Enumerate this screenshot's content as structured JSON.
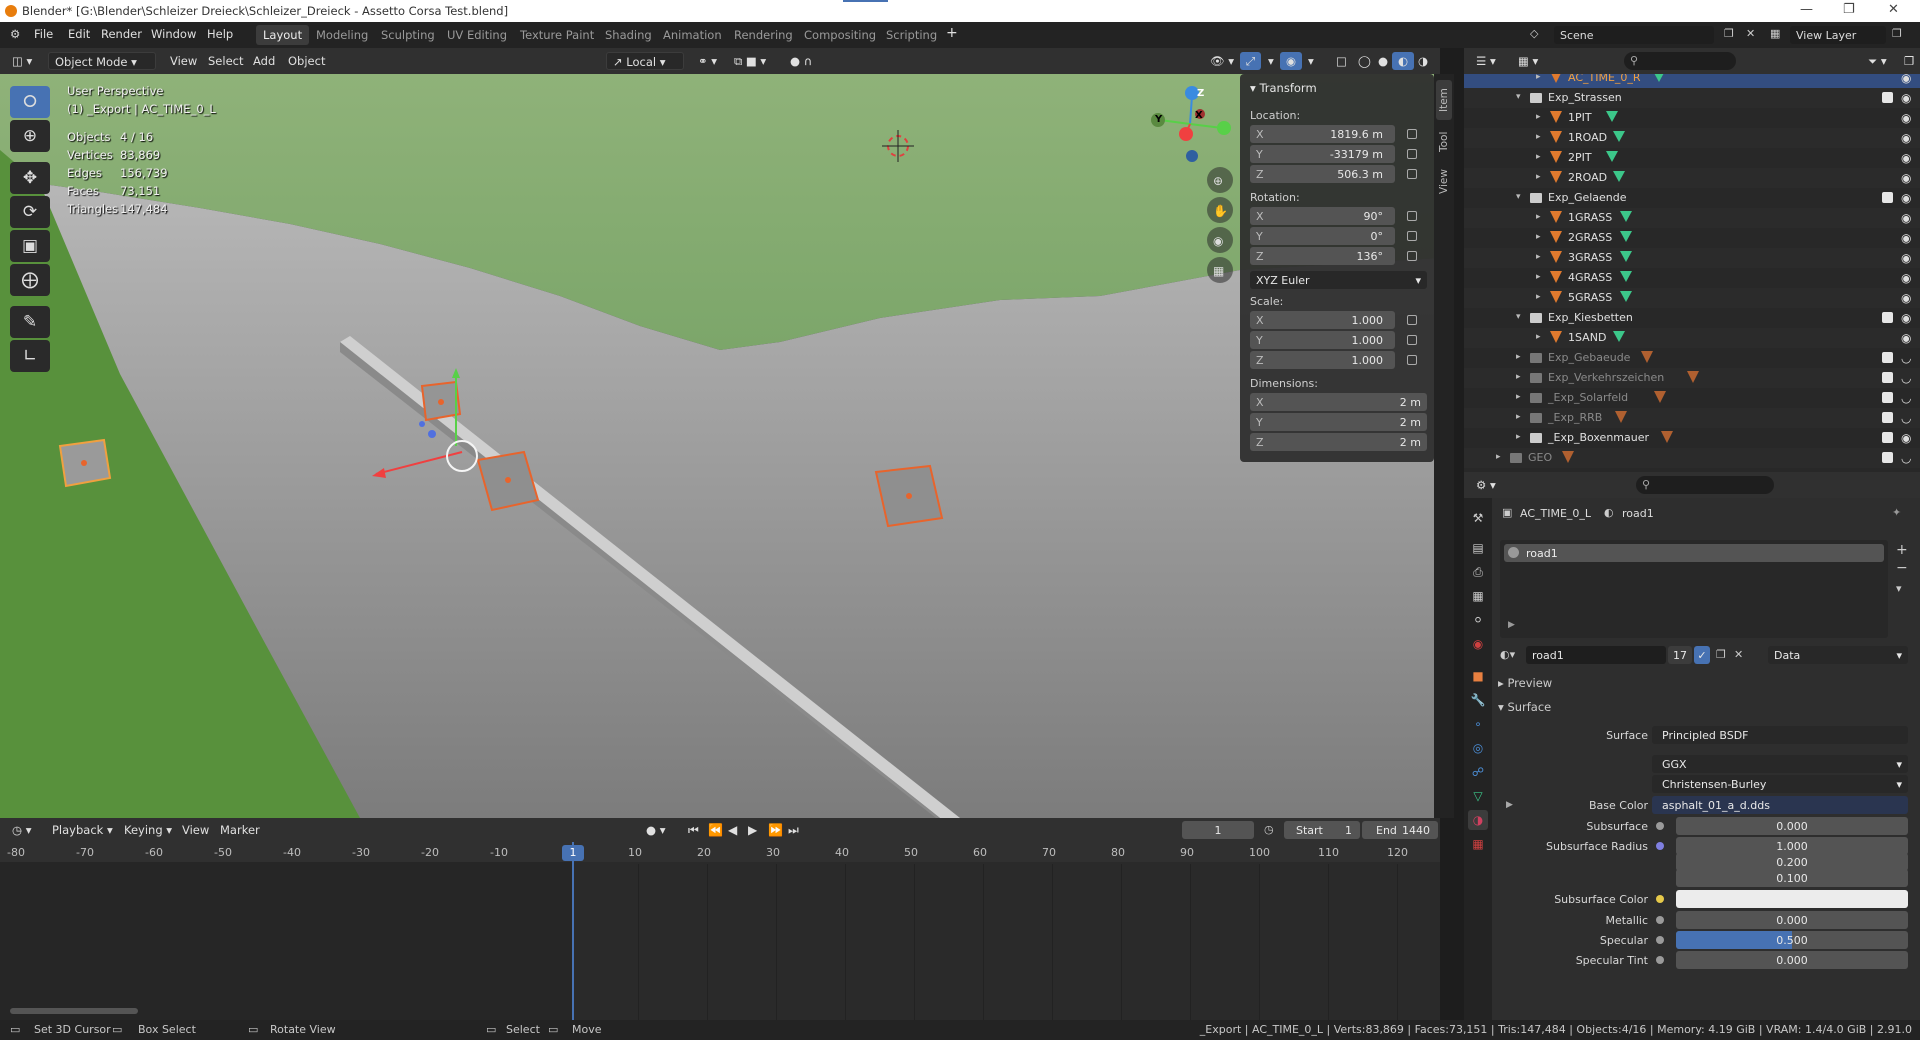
{
  "window": {
    "title": "Blender* [G:\\Blender\\Schleizer Dreieck\\Schleizer_Dreieck - Assetto Corsa Test.blend]"
  },
  "menu": {
    "items": [
      "File",
      "Edit",
      "Render",
      "Window",
      "Help"
    ]
  },
  "workspaces": [
    "Layout",
    "Modeling",
    "Sculpting",
    "UV Editing",
    "Texture Paint",
    "Shading",
    "Animation",
    "Rendering",
    "Compositing",
    "Scripting"
  ],
  "workspace_active": "Layout",
  "scene": {
    "name": "Scene",
    "view_layer": "View Layer"
  },
  "viewport_header": {
    "mode": "Object Mode",
    "view": "View",
    "select": "Select",
    "add": "Add",
    "object": "Object",
    "orientation": "Local"
  },
  "viewport": {
    "perspective": "User Perspective",
    "context": "(1) _Export | AC_TIME_0_L",
    "stats": [
      {
        "label": "Objects",
        "value": "4 / 16"
      },
      {
        "label": "Vertices",
        "value": "83,869"
      },
      {
        "label": "Edges",
        "value": "156,739"
      },
      {
        "label": "Faces",
        "value": "73,151"
      },
      {
        "label": "Triangles",
        "value": "147,484"
      }
    ],
    "gizmo_axes": {
      "x": "X",
      "y": "Y",
      "z": "Z"
    }
  },
  "npanel": {
    "title": "Transform",
    "tabs": [
      "Item",
      "Tool",
      "View"
    ],
    "location_label": "Location:",
    "location": [
      {
        "axis": "X",
        "value": "1819.6 m"
      },
      {
        "axis": "Y",
        "value": "-33179 m"
      },
      {
        "axis": "Z",
        "value": "506.3 m"
      }
    ],
    "rotation_label": "Rotation:",
    "rotation": [
      {
        "axis": "X",
        "value": "90°"
      },
      {
        "axis": "Y",
        "value": "0°"
      },
      {
        "axis": "Z",
        "value": "136°"
      }
    ],
    "rotation_mode": "XYZ Euler",
    "scale_label": "Scale:",
    "scale": [
      {
        "axis": "X",
        "value": "1.000"
      },
      {
        "axis": "Y",
        "value": "1.000"
      },
      {
        "axis": "Z",
        "value": "1.000"
      }
    ],
    "dimensions_label": "Dimensions:",
    "dimensions": [
      {
        "axis": "X",
        "value": "2 m"
      },
      {
        "axis": "Y",
        "value": "2 m"
      },
      {
        "axis": "Z",
        "value": "2 m"
      }
    ]
  },
  "outliner": {
    "rows": [
      {
        "label": "AC_TIME_0_R",
        "kind": "mesh",
        "indent": 3,
        "selected": true,
        "dim": false,
        "orange": true,
        "checkbox": false
      },
      {
        "label": "Exp_Strassen",
        "kind": "collection",
        "indent": 2,
        "selected": false,
        "dim": false,
        "orange": false,
        "checkbox": true
      },
      {
        "label": "1PIT",
        "kind": "mesh",
        "indent": 3,
        "selected": false,
        "dim": false,
        "orange": false,
        "checkbox": false
      },
      {
        "label": "1ROAD",
        "kind": "mesh",
        "indent": 3,
        "selected": false,
        "dim": false,
        "orange": false,
        "checkbox": false
      },
      {
        "label": "2PIT",
        "kind": "mesh",
        "indent": 3,
        "selected": false,
        "dim": false,
        "orange": false,
        "checkbox": false
      },
      {
        "label": "2ROAD",
        "kind": "mesh",
        "indent": 3,
        "selected": false,
        "dim": false,
        "orange": false,
        "checkbox": false
      },
      {
        "label": "Exp_Gelaende",
        "kind": "collection",
        "indent": 2,
        "selected": false,
        "dim": false,
        "orange": false,
        "checkbox": true
      },
      {
        "label": "1GRASS",
        "kind": "mesh",
        "indent": 3,
        "selected": false,
        "dim": false,
        "orange": false,
        "checkbox": false
      },
      {
        "label": "2GRASS",
        "kind": "mesh",
        "indent": 3,
        "selected": false,
        "dim": false,
        "orange": false,
        "checkbox": false
      },
      {
        "label": "3GRASS",
        "kind": "mesh",
        "indent": 3,
        "selected": false,
        "dim": false,
        "orange": false,
        "checkbox": false
      },
      {
        "label": "4GRASS",
        "kind": "mesh",
        "indent": 3,
        "selected": false,
        "dim": false,
        "orange": false,
        "checkbox": false
      },
      {
        "label": "5GRASS",
        "kind": "mesh",
        "indent": 3,
        "selected": false,
        "dim": false,
        "orange": false,
        "checkbox": false
      },
      {
        "label": "Exp_Kiesbetten",
        "kind": "collection",
        "indent": 2,
        "selected": false,
        "dim": false,
        "orange": false,
        "checkbox": true
      },
      {
        "label": "1SAND",
        "kind": "mesh",
        "indent": 3,
        "selected": false,
        "dim": false,
        "orange": false,
        "checkbox": false
      },
      {
        "label": "Exp_Gebaeude",
        "kind": "collection",
        "indent": 2,
        "selected": false,
        "dim": true,
        "orange": false,
        "checkbox": true
      },
      {
        "label": "Exp_Verkehrszeichen",
        "kind": "collection",
        "indent": 2,
        "selected": false,
        "dim": true,
        "orange": false,
        "checkbox": true
      },
      {
        "label": "_Exp_Solarfeld",
        "kind": "collection",
        "indent": 2,
        "selected": false,
        "dim": true,
        "orange": false,
        "checkbox": true
      },
      {
        "label": "_Exp_RRB",
        "kind": "collection",
        "indent": 2,
        "selected": false,
        "dim": true,
        "orange": false,
        "checkbox": true
      },
      {
        "label": "_Exp_Boxenmauer",
        "kind": "collection",
        "indent": 2,
        "selected": false,
        "dim": false,
        "orange": false,
        "checkbox": true
      },
      {
        "label": "GEO",
        "kind": "collection",
        "indent": 1,
        "selected": false,
        "dim": true,
        "orange": false,
        "checkbox": true
      }
    ]
  },
  "properties": {
    "breadcrumb_object": "AC_TIME_0_L",
    "breadcrumb_material": "road1",
    "slot_name": "road1",
    "material_name": "road1",
    "users": "17",
    "link": "Data",
    "preview_label": "Preview",
    "surface_label": "Surface",
    "rows": [
      {
        "label": "Surface",
        "value": "Principled BSDF",
        "dot": "#3cc760",
        "type": "link"
      },
      {
        "label": "",
        "value": "GGX",
        "dot": "",
        "type": "enum"
      },
      {
        "label": "",
        "value": "Christensen-Burley",
        "dot": "",
        "type": "enum"
      },
      {
        "label": "Base Color",
        "value": "asphalt_01_a_d.dds",
        "dot": "#e6c94a",
        "type": "link"
      },
      {
        "label": "Subsurface",
        "value": "0.000",
        "dot": "#9a9a9a",
        "type": "num"
      },
      {
        "label": "Subsurface Radius",
        "value": "1.000",
        "dot": "#7f7fe0",
        "type": "num"
      },
      {
        "label": "",
        "value": "0.200",
        "dot": "",
        "type": "num"
      },
      {
        "label": "",
        "value": "0.100",
        "dot": "",
        "type": "num"
      },
      {
        "label": "Subsurface Color",
        "value": "",
        "dot": "#e6c94a",
        "type": "color"
      },
      {
        "label": "Metallic",
        "value": "0.000",
        "dot": "#9a9a9a",
        "type": "num"
      },
      {
        "label": "Specular",
        "value": "0.500",
        "dot": "#9a9a9a",
        "type": "slider"
      },
      {
        "label": "Specular Tint",
        "value": "0.000",
        "dot": "#9a9a9a",
        "type": "num"
      }
    ],
    "specular_fill": 0.5
  },
  "timeline": {
    "menu": [
      "Playback",
      "Keying",
      "View",
      "Marker"
    ],
    "current_frame": "1",
    "start_label": "Start",
    "start": "1",
    "end_label": "End",
    "end": "1440",
    "ticks": [
      "-80",
      "-70",
      "-60",
      "-50",
      "-40",
      "-30",
      "-20",
      "-10",
      "1",
      "10",
      "20",
      "30",
      "40",
      "50",
      "60",
      "70",
      "80",
      "90",
      "100",
      "110",
      "120"
    ]
  },
  "statusbar": {
    "hints": [
      "Set 3D Cursor",
      "Box Select",
      "Rotate View",
      "Select",
      "Move"
    ],
    "info": "_Export | AC_TIME_0_L | Verts:83,869 | Faces:73,151 | Tris:147,484 | Objects:4/16 | Memory: 4.19 GiB | VRAM: 1.4/4.0 GiB | 2.91.0"
  },
  "colors": {
    "accent": "#4772b3",
    "selected_object": "#e8642c",
    "active_outline": "#f0a040"
  }
}
